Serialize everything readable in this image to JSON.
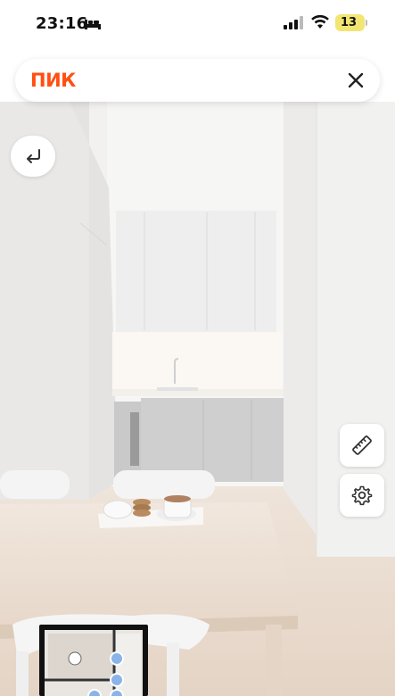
{
  "status_bar": {
    "time": "23:16",
    "battery_level": "13",
    "icons": [
      "bed-icon",
      "signal-icon",
      "wifi-icon",
      "battery-icon"
    ]
  },
  "header": {
    "logo_text": "ПИК",
    "logo_color": "#ff4f12",
    "close_icon": "close-icon"
  },
  "controls": {
    "back_icon": "return-arrow-icon",
    "ruler_icon": "ruler-icon",
    "settings_icon": "gear-icon"
  },
  "minimap": {
    "icon": "floor-plan-minimap"
  }
}
